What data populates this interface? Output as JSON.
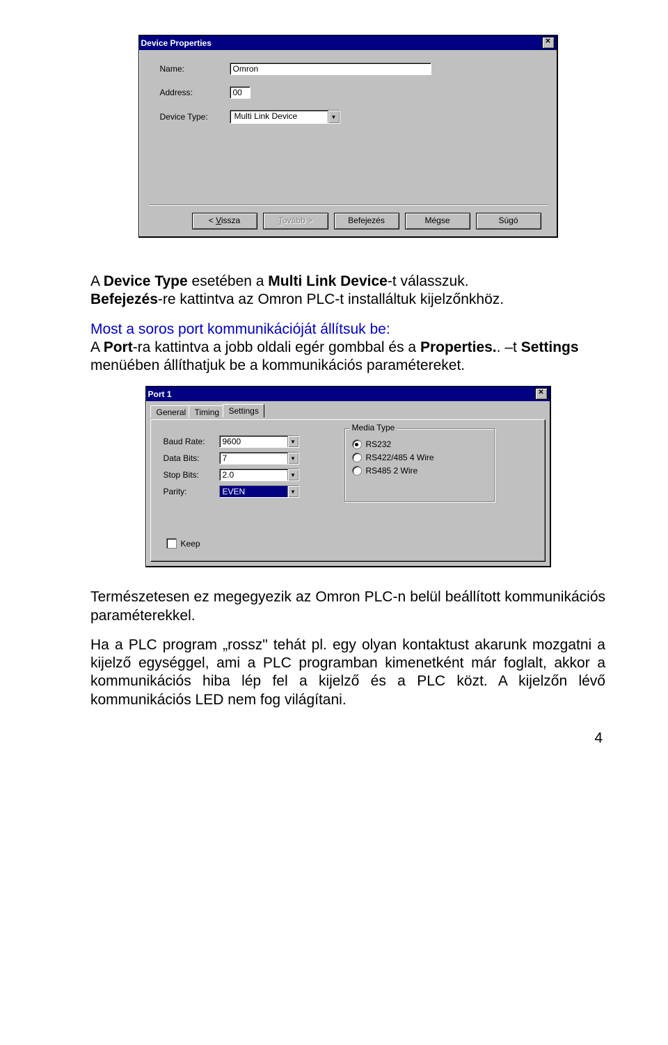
{
  "dialog1": {
    "title": "Device Properties",
    "close": "✕",
    "name_label": "Name:",
    "name_value": "Omron",
    "address_label": "Address:",
    "address_value": "00",
    "devicetype_label": "Device Type:",
    "devicetype_value": "Multi Link Device",
    "buttons": {
      "back_prefix": "< ",
      "back_u": "V",
      "back_rest": "issza",
      "next_u": "T",
      "next_rest": "ovább >",
      "finish": "Befejezés",
      "cancel": "Mégse",
      "help": "Súgó"
    }
  },
  "para1": {
    "t1": "A ",
    "b1": "Device Type",
    "t2": " esetében a ",
    "b2": "Multi Link Device",
    "t3": "-t válasszuk.",
    "line2a": "Befejezés",
    "line2b": "-re kattintva az Omron PLC-t installáltuk kijelzőnkhöz."
  },
  "para2": {
    "l1": "Most a soros port kommunikációját állítsuk be:",
    "l2a": "A ",
    "l2b": "Port",
    "l2c": "-ra kattintva a jobb oldali egér gombbal és a ",
    "l2d": "Properties.",
    "l2e": ". –t ",
    "l3a": "Settings",
    "l3b": " menüében állíthatjuk be a kommunikációs paramétereket."
  },
  "dialog2": {
    "title": "Port 1",
    "close": "✕",
    "tabs": {
      "general": "General",
      "timing": "Timing",
      "settings": "Settings"
    },
    "baud_label": "Baud Rate:",
    "baud_value": "9600",
    "databits_label": "Data Bits:",
    "databits_value": "7",
    "stopbits_label": "Stop Bits:",
    "stopbits_value": "2.0",
    "parity_label": "Parity:",
    "parity_value": "EVEN",
    "media_title": "Media Type",
    "media_rs232": "RS232",
    "media_rs422": "RS422/485 4 Wire",
    "media_rs485": "RS485 2 Wire",
    "keep_label": "Keep"
  },
  "para3": "Természetesen ez megegyezik az Omron PLC-n belül beállított kommunikációs paraméterekkel.",
  "para4": "Ha a PLC program „rossz\" tehát pl. egy olyan kontaktust akarunk mozgatni a kijelző egységgel, ami a PLC programban kimenetként már foglalt, akkor a kommunikációs hiba lép fel a kijelző és a PLC közt. A kijelzőn lévő kommunikációs LED nem fog világítani.",
  "page_number": "4"
}
